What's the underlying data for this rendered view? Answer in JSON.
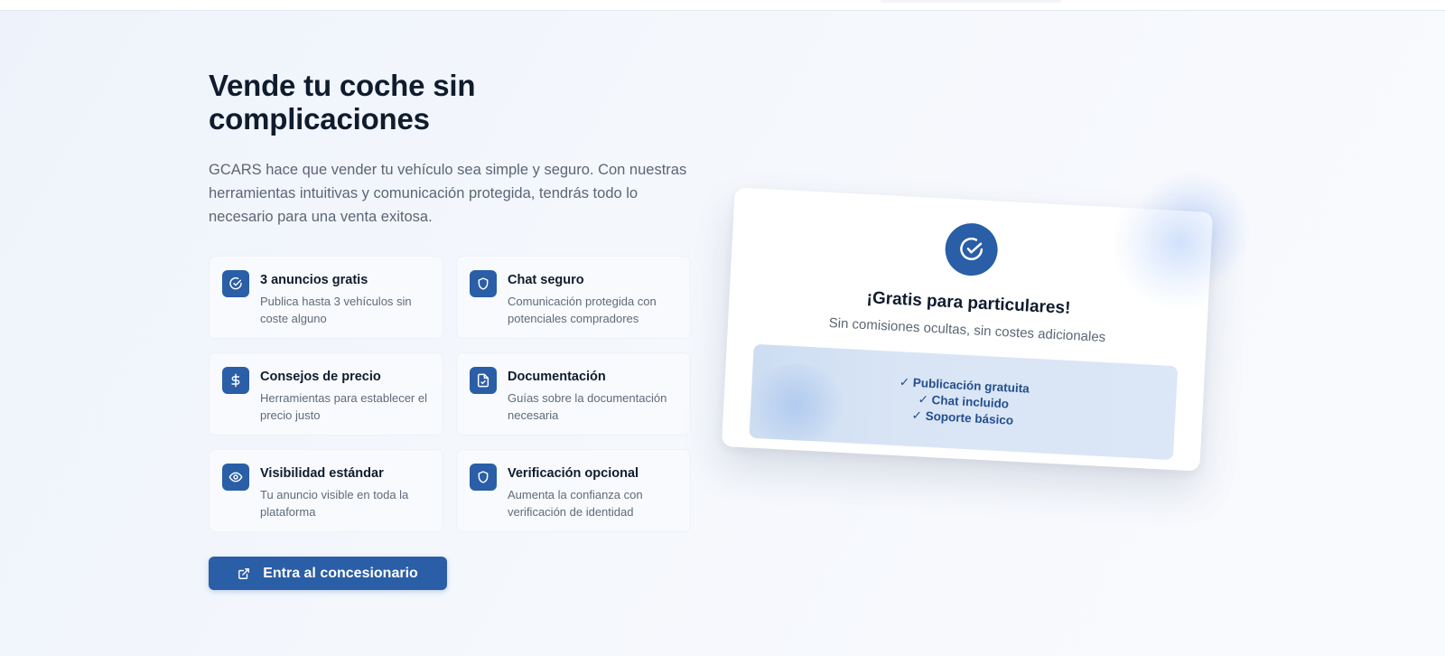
{
  "hero": {
    "headline": "Vende tu coche sin complicaciones",
    "intro": "GCARS hace que vender tu vehículo sea simple y seguro. Con nuestras herramientas intuitivas y comunicación protegida, tendrás todo lo necesario para una venta exitosa.",
    "cta_label": "Entra al concesionario",
    "cta_icon": "external-link-icon"
  },
  "features": [
    {
      "icon": "check-circle-icon",
      "title": "3 anuncios gratis",
      "desc": "Publica hasta 3 vehículos sin coste alguno"
    },
    {
      "icon": "shield-icon",
      "title": "Chat seguro",
      "desc": "Comunicación protegida con potenciales compradores"
    },
    {
      "icon": "dollar-icon",
      "title": "Consejos de precio",
      "desc": "Herramientas para establecer el precio justo"
    },
    {
      "icon": "document-check-icon",
      "title": "Documentación",
      "desc": "Guías sobre la documentación necesaria"
    },
    {
      "icon": "eye-icon",
      "title": "Visibilidad estándar",
      "desc": "Tu anuncio visible en toda la plataforma"
    },
    {
      "icon": "shield-icon",
      "title": "Verificación opcional",
      "desc": "Aumenta la confianza con verificación de identidad"
    }
  ],
  "promo_card": {
    "icon": "check-circle-icon",
    "title": "¡Gratis para particulares!",
    "subtitle": "Sin comisiones ocultas, sin costes adicionales",
    "perks": [
      "✓ Publicación gratuita",
      "✓ Chat incluido",
      "✓ Soporte básico"
    ]
  },
  "colors": {
    "brand": "#2a5ea6",
    "heading": "#0f1c2e",
    "body_text": "#5b6675",
    "perk_box": "#d9e5f5"
  }
}
